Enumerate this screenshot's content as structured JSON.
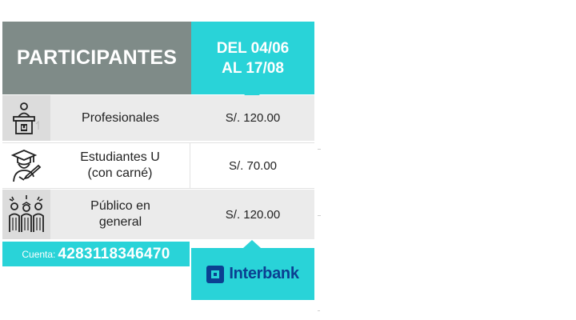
{
  "header": {
    "title": "PARTICIPANTES",
    "date_line1": "DEL 04/06",
    "date_line2": "AL 17/08"
  },
  "rows": [
    {
      "label_line1": "Profesionales",
      "label_line2": "",
      "price": "S/. 120.00",
      "icon": "podium-speaker-icon"
    },
    {
      "label_line1": "Estudiantes U",
      "label_line2": "(con carné)",
      "price": "S/. 70.00",
      "icon": "graduate-student-icon"
    },
    {
      "label_line1": "Público en",
      "label_line2": "general",
      "price": "S/. 120.00",
      "icon": "audience-icon"
    }
  ],
  "account": {
    "label": "Cuenta:",
    "number": "4283118346470"
  },
  "bank": {
    "name": "Interbank",
    "icon": "interbank-logo-icon"
  },
  "colors": {
    "teal": "#29d3d8",
    "gray_header": "#7f8b88",
    "row_bg": "#ebebeb",
    "bank_blue": "#0b3f91"
  }
}
